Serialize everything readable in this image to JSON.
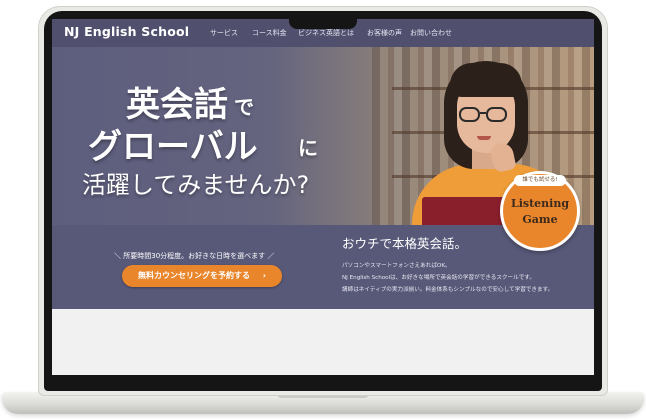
{
  "nav": {
    "logo": "NJ English School",
    "links": [
      "サービス",
      "コース料金",
      "ビジネス英語とは",
      "お客様の声",
      "お問い合わせ"
    ]
  },
  "hero": {
    "headline": {
      "line1_main": "英会話",
      "line1_particle": "で",
      "line2_main": "グローバル",
      "line2_particle": "に",
      "line3": "活躍してみませんか?"
    },
    "badge": {
      "pill": "誰でも試せる!",
      "line1": "Listening",
      "line2": "Game"
    }
  },
  "cta_section": {
    "note": "所要時間30分程度。お好きな日時を選べます",
    "button_label": "無料カウンセリングを予約する",
    "button_chevron": "›"
  },
  "intro": {
    "heading": "おウチで本格英会話。",
    "lines": [
      "パソコンやスマートフォンさえあればOK。",
      "NJ English Schoolは、お好きな場所で英会話の学習ができるスクールです。",
      "講師はネイティブの実力派揃い。料金体系もシンプルなので安心して学習できます。"
    ]
  },
  "colors": {
    "nav_bg": "#50506e",
    "hero_bg": "#5d5d7e",
    "accent_orange": "#e9862c"
  }
}
